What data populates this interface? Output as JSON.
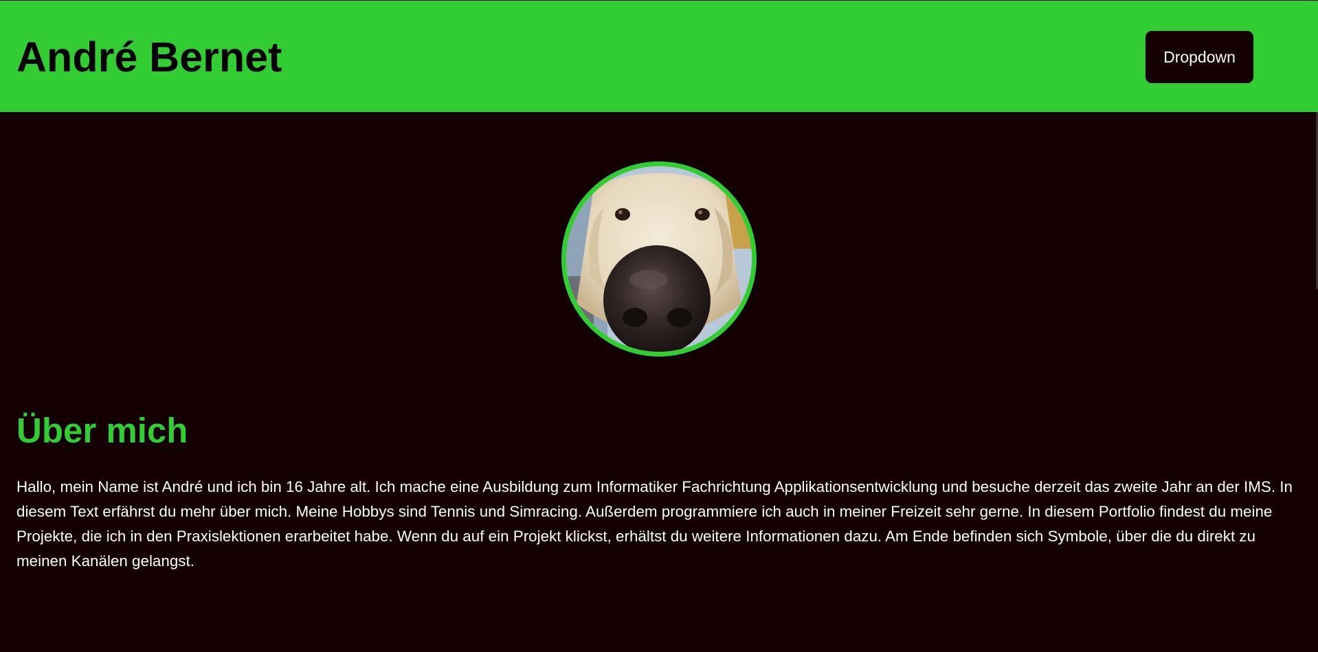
{
  "header": {
    "title": "André Bernet",
    "dropdown_label": "Dropdown"
  },
  "profile": {
    "avatar_icon": "dog-portrait-photo"
  },
  "about": {
    "heading": "Über mich",
    "text": "Hallo, mein Name ist André und ich bin 16 Jahre alt. Ich mache eine Ausbildung zum Informatiker Fachrichtung Applikationsentwicklung und besuche derzeit das zweite Jahr an der IMS. In diesem Text erfährst du mehr über mich. Meine Hobbys sind Tennis und Simracing. Außerdem programmiere ich auch in meiner Freizeit sehr gerne. In diesem Portfolio findest du meine Projekte, die ich in den Praxislektionen erarbeitet habe. Wenn du auf ein Projekt klickst, erhältst du weitere Informationen dazu. Am Ende befinden sich Symbole, über die du direkt zu meinen Kanälen gelangst."
  },
  "colors": {
    "accent": "#32cd32",
    "background": "#140001",
    "text": "#ffffff"
  }
}
